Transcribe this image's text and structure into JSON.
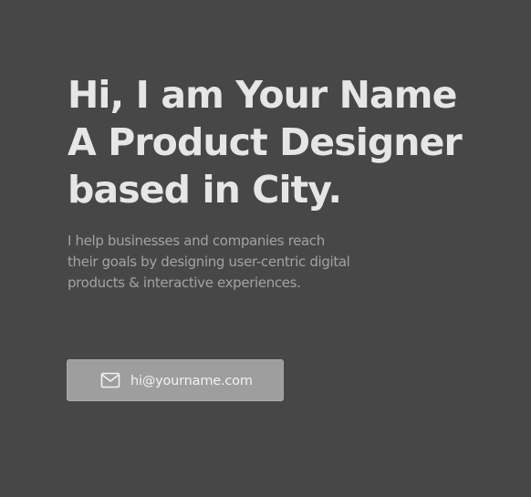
{
  "hero": {
    "headline_lines": [
      "Hi, I am Your Name",
      "A Product Designer",
      "based in City."
    ],
    "intro_lines": [
      "I help businesses and companies reach",
      "their goals by designing user-centric digital",
      "products & interactive experiences."
    ]
  },
  "cta": {
    "icon": "mail-icon",
    "label": "hi@yourname.com"
  },
  "colors": {
    "background": "#474747",
    "headline": "#e6e6e6",
    "intro": "#a3a3a3",
    "button": "#9e9e9e"
  }
}
